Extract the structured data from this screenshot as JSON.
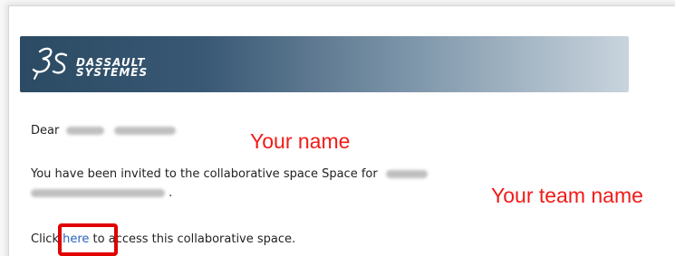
{
  "brand": {
    "line1": "DASSAULT",
    "line2": "SYSTEMES"
  },
  "email": {
    "salutation": "Dear",
    "invite_text": "You have been invited to the collaborative space Space for",
    "team_tail": ".",
    "click_prefix": "Clic",
    "click_k": "k",
    "link_label": "here",
    "click_t": " t",
    "click_suffix": "o access this collaborative space."
  },
  "annotations": {
    "your_name": "Your name",
    "your_team_name": "Your team name"
  },
  "colors": {
    "annotation": "#ef1b17",
    "link": "#2a63b8",
    "banner_start": "#2b4a63",
    "banner_end": "#c9d4dd"
  }
}
